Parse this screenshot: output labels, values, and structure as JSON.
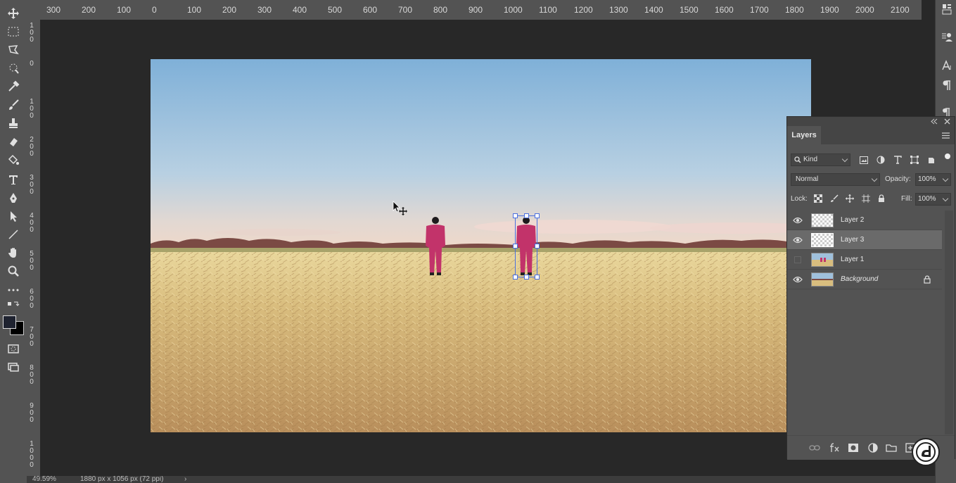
{
  "ruler": {
    "top_labels": [
      "300",
      "200",
      "100",
      "0",
      "100",
      "200",
      "300",
      "400",
      "500",
      "600",
      "700",
      "800",
      "900",
      "1000",
      "1100",
      "1200",
      "1300",
      "1400",
      "1500",
      "1600",
      "1700",
      "1800",
      "1900",
      "2000",
      "2100"
    ],
    "left_labels": [
      "100",
      "0",
      "100",
      "200",
      "300",
      "400",
      "500",
      "600",
      "700",
      "800",
      "900",
      "1000"
    ]
  },
  "toolbar": {
    "tools": [
      "move-icon",
      "marquee-icon",
      "lasso-icon",
      "quick-select-icon",
      "eyedropper-icon",
      "brush-icon",
      "stamp-icon",
      "eraser-icon",
      "paint-bucket-icon",
      "type-icon",
      "pen-icon",
      "path-select-icon",
      "line-icon",
      "hand-icon",
      "zoom-icon",
      "more-icon",
      "swap-colors-icon",
      "color-swatches",
      "quick-mask-icon",
      "screen-mode-icon"
    ],
    "foreground_color": "#1f2330",
    "background_color": "#000000"
  },
  "status": {
    "zoom": "49.59%",
    "doc_size": "1880 px x 1056 px (72 ppi)",
    "arrow": "›"
  },
  "layers_panel": {
    "tab": "Layers",
    "filter_kind": "Kind",
    "blend_mode": "Normal",
    "opacity_label": "Opacity:",
    "opacity": "100%",
    "lock_label": "Lock:",
    "fill_label": "Fill:",
    "fill": "100%",
    "layers": [
      {
        "name": "Layer 2",
        "visible": true,
        "selected": false,
        "thumb": "checker",
        "italic": false,
        "locked": false
      },
      {
        "name": "Layer 3",
        "visible": true,
        "selected": true,
        "thumb": "checker",
        "italic": false,
        "locked": false
      },
      {
        "name": "Layer 1",
        "visible": false,
        "selected": false,
        "thumb": "photo",
        "italic": false,
        "locked": false
      },
      {
        "name": "Background",
        "visible": true,
        "selected": false,
        "thumb": "photo",
        "italic": true,
        "locked": true
      }
    ],
    "bottom_icons": [
      "link-icon",
      "fx-icon",
      "mask-icon",
      "adjustment-icon",
      "folder-icon",
      "new-layer-icon"
    ]
  },
  "right_dock": {
    "icons": [
      "properties-icon",
      "character-styles-icon",
      "character-icon",
      "paragraph-icon",
      "paragraph-styles-icon"
    ]
  },
  "colors": {
    "ui_dark": "#282828",
    "panel": "#535353",
    "selection": "#6a6a6a",
    "transform_handle": "#4a6fe0"
  }
}
